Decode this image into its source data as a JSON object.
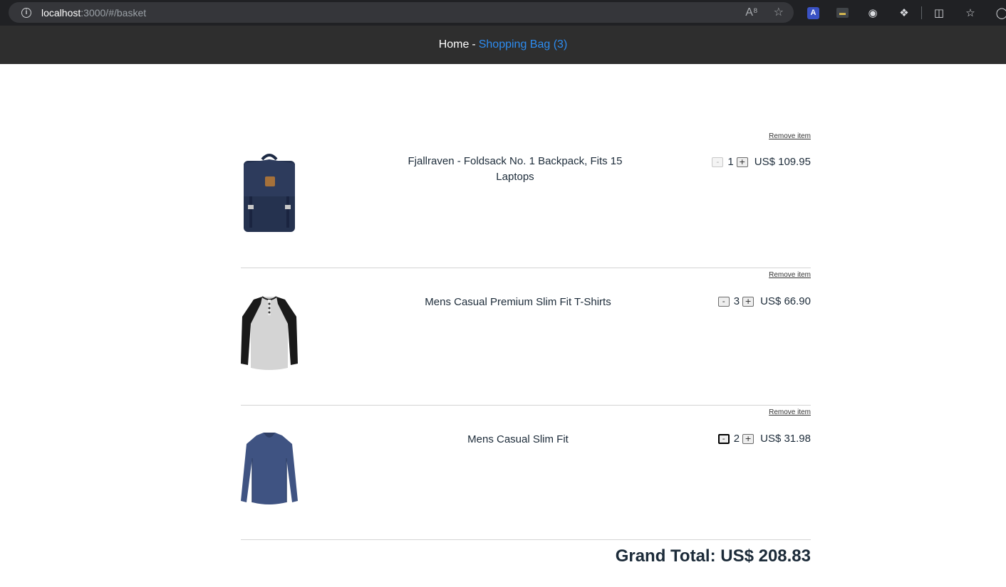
{
  "browser": {
    "url_host": "localhost",
    "url_rest": ":3000/#/basket"
  },
  "header": {
    "home_label": "Home",
    "separator": "-",
    "bag_label": "Shopping Bag (3)"
  },
  "basket": {
    "items": [
      {
        "title": "Fjallraven - Foldsack No. 1 Backpack, Fits 15 Laptops",
        "remove_label": "Remove item",
        "quantity": "1",
        "price": "US$ 109.95",
        "minus_label": "-",
        "plus_label": "+",
        "image": "backpack-image"
      },
      {
        "title": "Mens Casual Premium Slim Fit T-Shirts",
        "remove_label": "Remove item",
        "quantity": "3",
        "price": "US$ 66.90",
        "minus_label": "-",
        "plus_label": "+",
        "image": "tshirt-image"
      },
      {
        "title": "Mens Casual Slim Fit",
        "remove_label": "Remove item",
        "quantity": "2",
        "price": "US$ 31.98",
        "minus_label": "-",
        "plus_label": "+",
        "image": "longsleeve-image"
      }
    ],
    "grand_total": "Grand Total: US$ 208.83"
  },
  "colors": {
    "header_bg": "#2e2e2e",
    "link_blue": "#2d8cf0",
    "text": "#1c2b39"
  }
}
